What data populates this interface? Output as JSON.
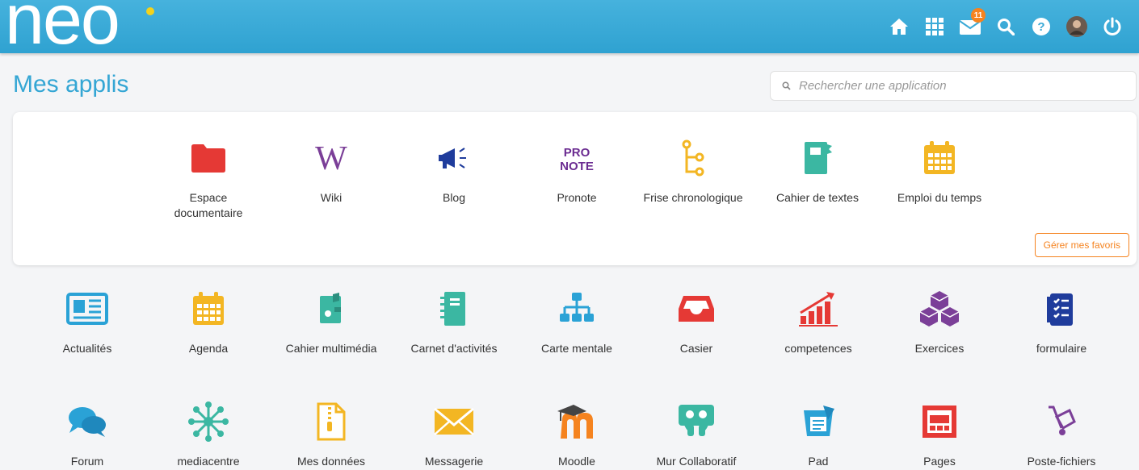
{
  "header": {
    "logo_text": "neo",
    "mail_badge": "11"
  },
  "page": {
    "title": "Mes applis",
    "search_placeholder": "Rechercher une application"
  },
  "favorites": {
    "manage_label": "Gérer mes favoris",
    "items": [
      {
        "label": "Espace documentaire",
        "icon": "folder-icon",
        "color": "#e53935"
      },
      {
        "label": "Wiki",
        "icon": "wiki-icon",
        "color": "#7b3f98"
      },
      {
        "label": "Blog",
        "icon": "megaphone-icon",
        "color": "#1f3c9c"
      },
      {
        "label": "Pronote",
        "icon": "pronote-icon",
        "color": "#6b2c91"
      },
      {
        "label": "Frise chronologique",
        "icon": "timeline-icon",
        "color": "#f3b623"
      },
      {
        "label": "Cahier de textes",
        "icon": "notebook-icon",
        "color": "#3bb7a2"
      },
      {
        "label": "Emploi du temps",
        "icon": "calendar-icon",
        "color": "#f3b623"
      }
    ]
  },
  "apps_row1": [
    {
      "label": "Actualités",
      "icon": "newspaper-icon",
      "color": "#2aa2d6"
    },
    {
      "label": "Agenda",
      "icon": "calendar-icon",
      "color": "#f3b623"
    },
    {
      "label": "Cahier multimédia",
      "icon": "multimedia-book-icon",
      "color": "#3bb7a2"
    },
    {
      "label": "Carnet d'activités",
      "icon": "activity-notebook-icon",
      "color": "#3bb7a2"
    },
    {
      "label": "Carte mentale",
      "icon": "mindmap-icon",
      "color": "#2aa2d6"
    },
    {
      "label": "Casier",
      "icon": "inbox-tray-icon",
      "color": "#e53935"
    },
    {
      "label": "competences",
      "icon": "growth-chart-icon",
      "color": "#e53935"
    },
    {
      "label": "Exercices",
      "icon": "cubes-icon",
      "color": "#7b3f98"
    },
    {
      "label": "formulaire",
      "icon": "checklist-icon",
      "color": "#1f3c9c"
    }
  ],
  "apps_row2": [
    {
      "label": "Forum",
      "icon": "chat-bubbles-icon",
      "color": "#2aa2d6"
    },
    {
      "label": "mediacentre",
      "icon": "network-star-icon",
      "color": "#3bb7a2"
    },
    {
      "label": "Mes données",
      "icon": "zip-file-icon",
      "color": "#f3b623"
    },
    {
      "label": "Messagerie",
      "icon": "envelope-icon",
      "color": "#f3b623"
    },
    {
      "label": "Moodle",
      "icon": "moodle-icon",
      "color": "#f5831f"
    },
    {
      "label": "Mur Collaboratif",
      "icon": "collab-wall-icon",
      "color": "#3bb7a2"
    },
    {
      "label": "Pad",
      "icon": "pad-icon",
      "color": "#2aa2d6"
    },
    {
      "label": "Pages",
      "icon": "pages-icon",
      "color": "#e53935"
    },
    {
      "label": "Poste-fichiers",
      "icon": "hand-truck-icon",
      "color": "#7b3f98"
    }
  ]
}
